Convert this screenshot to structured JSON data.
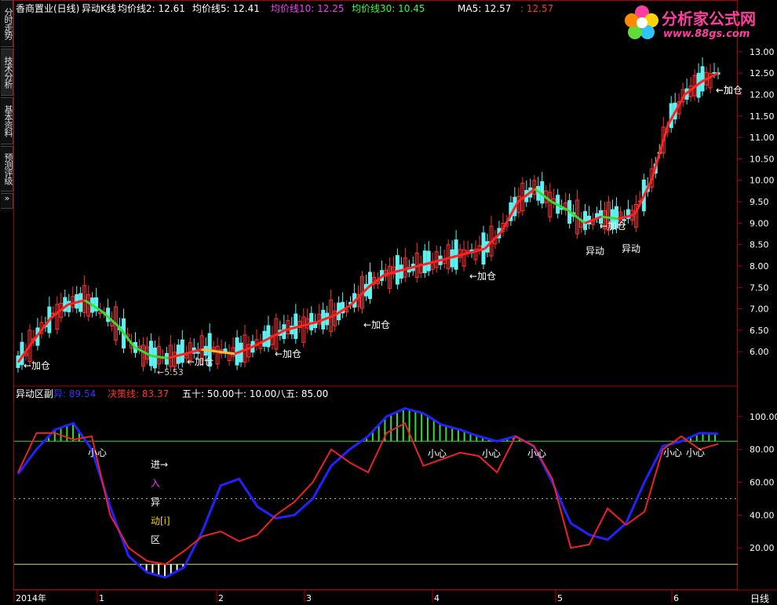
{
  "side_tabs": [
    "分时走势",
    "技术分析",
    "基本资料",
    "预测评级",
    "»"
  ],
  "top_legend": {
    "title": "香商置业(日线)",
    "indicator": "异动K线",
    "items": [
      {
        "label": "均价线2: 12.61",
        "color": "#ffffff"
      },
      {
        "label": "均价线5: 12.41",
        "color": "#ffffff"
      },
      {
        "label": "均价线10: 12.25",
        "color": "#ff33ff"
      },
      {
        "label": "均价线30: 10.45",
        "color": "#33ff33"
      },
      {
        "label": "MA5: 12.57",
        "color": "#ffffff"
      },
      {
        "label": ": 12.57",
        "color": "#ff3333"
      }
    ]
  },
  "logo": {
    "name": "分析家公式网",
    "url": "www.88gs.com"
  },
  "bottom_legend": {
    "title": "异动区副",
    "items": [
      {
        "label": "异: 89.54",
        "color": "#3333ff"
      },
      {
        "label": "决策线: 83.37",
        "color": "#ff3333"
      },
      {
        "label": "五十: 50.00",
        "color": "#ffffff"
      },
      {
        "label": "十: 10.00",
        "color": "#ffffff"
      },
      {
        "label": "八五: 85.00",
        "color": "#ffffff"
      }
    ]
  },
  "annotations": {
    "jiacang": [
      "←加仓",
      "←加仓",
      "←加仓",
      "←加仓",
      "←加仓",
      "←加仓",
      "←加仓",
      "←加"
    ],
    "yidong": [
      "异动",
      "异动"
    ],
    "low_label": "←5.53",
    "xiaoxin": [
      "小心",
      "小心",
      "小心",
      "小心",
      "小心",
      "小心"
    ],
    "vertical_text": [
      "进→",
      "入",
      "异",
      "动[i]",
      "区"
    ]
  },
  "period_label": "日线",
  "chart_data": [
    {
      "type": "line",
      "title": "香商置业(日线)",
      "ylim": [
        5.6,
        13.2
      ],
      "y_ticks": [
        "6.00",
        "6.50",
        "7.00",
        "7.50",
        "8.00",
        "8.50",
        "9.00",
        "9.50",
        "10.00",
        "10.50",
        "11.00",
        "11.50",
        "12.00",
        "12.50",
        "13.00"
      ],
      "x_labels": [
        "2014年",
        "1",
        "2",
        "3",
        "4",
        "5",
        "6"
      ],
      "series": [
        {
          "name": "均价线",
          "values": [
            5.75,
            6.3,
            6.8,
            7.1,
            7.2,
            6.95,
            6.6,
            6.1,
            5.9,
            5.85,
            5.95,
            6.05,
            6.0,
            5.95,
            6.1,
            6.3,
            6.5,
            6.6,
            6.7,
            6.85,
            7.1,
            7.5,
            7.8,
            7.9,
            8.0,
            8.1,
            8.2,
            8.3,
            8.4,
            8.8,
            9.5,
            9.8,
            9.5,
            9.3,
            9.0,
            9.15,
            9.1,
            9.2,
            10.0,
            11.3,
            12.0,
            12.3,
            12.5
          ]
        }
      ]
    },
    {
      "type": "line",
      "title": "异动区副",
      "ylim": [
        0,
        110
      ],
      "y_ticks": [
        "20.00",
        "40.00",
        "60.00",
        "80.00",
        "100.00"
      ],
      "x_labels": [
        "2014年",
        "1",
        "2",
        "3",
        "4",
        "5",
        "6"
      ],
      "series": [
        {
          "name": "异",
          "values": [
            65,
            80,
            92,
            96,
            80,
            45,
            15,
            5,
            2,
            8,
            30,
            58,
            62,
            45,
            38,
            40,
            50,
            70,
            80,
            88,
            100,
            105,
            102,
            95,
            92,
            88,
            85,
            88,
            82,
            60,
            35,
            28,
            25,
            35,
            60,
            82,
            85,
            90,
            89.54
          ]
        },
        {
          "name": "决策线",
          "values": [
            66,
            90,
            90,
            86,
            88,
            40,
            20,
            12,
            10,
            18,
            27,
            30,
            24,
            28,
            40,
            48,
            60,
            80,
            72,
            66,
            90,
            96,
            70,
            74,
            78,
            76,
            66,
            88,
            82,
            62,
            20,
            22,
            44,
            34,
            42,
            80,
            88,
            80,
            83.37
          ]
        }
      ]
    }
  ]
}
